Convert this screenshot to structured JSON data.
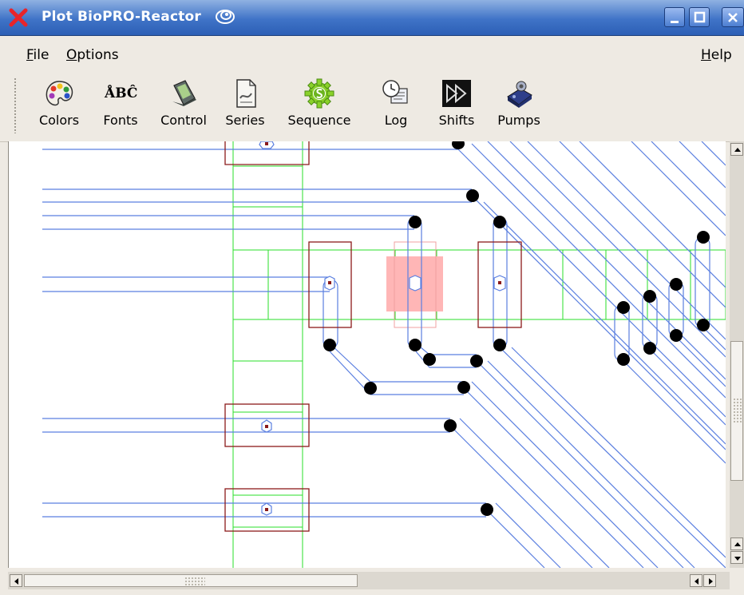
{
  "window": {
    "title": "Plot BioPRO-Reactor",
    "controls": [
      "minimize",
      "maximize",
      "close"
    ]
  },
  "menubar": {
    "items": [
      {
        "label": "File",
        "mnemonic": "F"
      },
      {
        "label": "Options",
        "mnemonic": "O"
      }
    ],
    "help": {
      "label": "Help",
      "mnemonic": "H"
    }
  },
  "toolbar": {
    "buttons": [
      {
        "label": "Colors",
        "icon": "palette-icon"
      },
      {
        "label": "Fonts",
        "icon": "fonts-icon"
      },
      {
        "label": "Control",
        "icon": "pda-control-icon"
      },
      {
        "label": "Series",
        "icon": "document-series-icon"
      },
      {
        "label": "Sequence",
        "icon": "gear-s-icon"
      },
      {
        "label": "Log",
        "icon": "clock-log-icon"
      },
      {
        "label": "Shifts",
        "icon": "fast-forward-icon"
      },
      {
        "label": "Pumps",
        "icon": "pump-icon"
      }
    ],
    "fonts_glyph": "ÅBĈ"
  },
  "colors": {
    "titlebar": "#3f73c7",
    "wire": "#5b7fe0",
    "grid": "#2adf2a",
    "module_border": "#8b1a1a",
    "highlight": "#ffb6b6",
    "node": "#000000"
  }
}
